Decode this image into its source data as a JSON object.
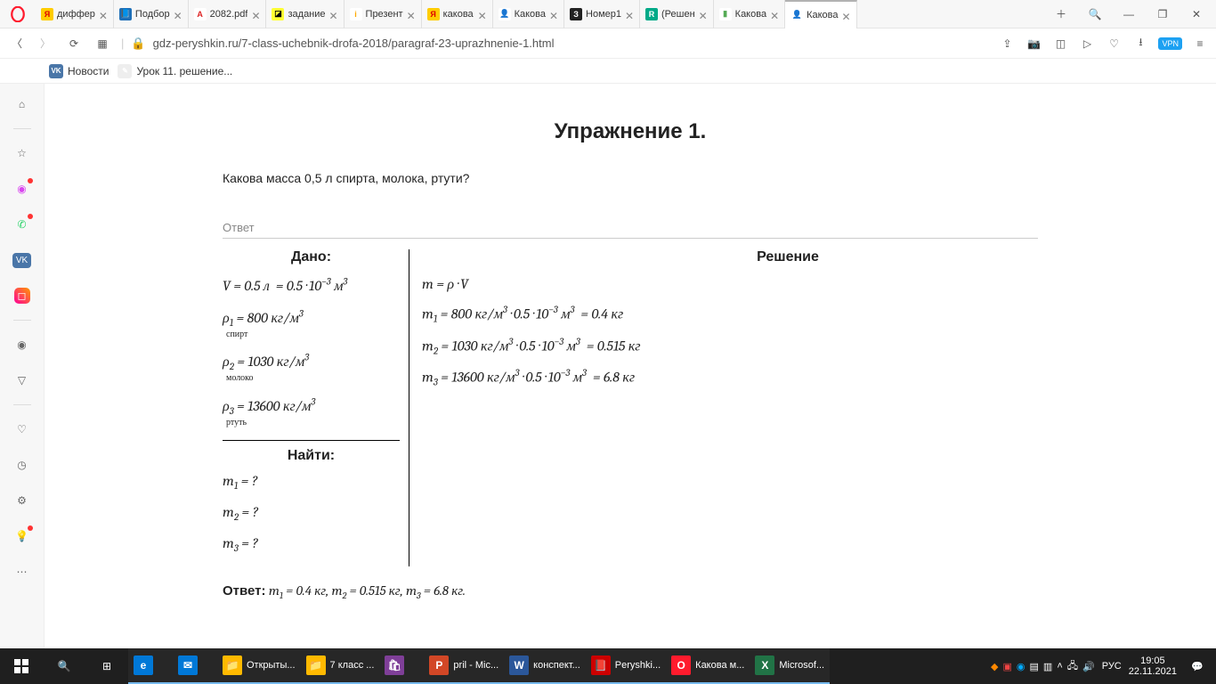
{
  "tabs": [
    {
      "label": "диффер",
      "color": "#ffcc00",
      "fg": "#d00",
      "letter": "Я"
    },
    {
      "label": "Подбор",
      "color": "#1e6fb8",
      "fg": "#fff",
      "letter": "📘"
    },
    {
      "label": "2082.pdf",
      "color": "#fff",
      "fg": "#d22",
      "letter": "A"
    },
    {
      "label": "задание",
      "color": "#ff3",
      "fg": "#000",
      "letter": "◪"
    },
    {
      "label": "Презент",
      "color": "#fff",
      "fg": "#fa0",
      "letter": "i"
    },
    {
      "label": "какова",
      "color": "#ffcc00",
      "fg": "#d00",
      "letter": "Я"
    },
    {
      "label": "Какова",
      "color": "#fff",
      "fg": "#b77",
      "letter": "👤"
    },
    {
      "label": "Номер1",
      "color": "#222",
      "fg": "#fff",
      "letter": "З"
    },
    {
      "label": "(Решен",
      "color": "#0a8",
      "fg": "#fff",
      "letter": "R"
    },
    {
      "label": "Какова",
      "color": "#fff",
      "fg": "#5a5",
      "letter": "▮"
    },
    {
      "label": "Какова",
      "color": "#fff",
      "fg": "#b77",
      "letter": "👤",
      "active": true
    }
  ],
  "url": "gdz-peryshkin.ru/7-class-uchebnik-drofa-2018/paragraf-23-uprazhnenie-1.html",
  "bookmarks": [
    {
      "label": "Новости",
      "bg": "#4a76a8",
      "letter": "VK"
    },
    {
      "label": "Урок 11. решение...",
      "bg": "#eee",
      "letter": "✎"
    }
  ],
  "page": {
    "title": "Упражнение 1.",
    "question": "Какова масса 0,5 л спирта, молока, ртути?",
    "answer_label": "Ответ",
    "dano": "Дано:",
    "g1": "V = 0.5 л  = 0.5 · 10⁻³ м³",
    "g2": "ρ₁ = 800 кг/м³",
    "g2n": "спирт",
    "g3": "ρ₂ = 1030 кг/м³",
    "g3n": "молоко",
    "g4": "ρ₃ = 13600 кг/м³",
    "g4n": "ртуть",
    "naiti": "Найти:",
    "f1": "m₁ = ?",
    "f2": "m₂ = ?",
    "f3": "m₃ = ?",
    "resh": "Решение",
    "s0": "m = ρ · V",
    "s1": "m₁ = 800 кг/м³ · 0.5 · 10⁻³ м³  = 0.4 кг",
    "s2": "m₂ = 1030 кг/м³ · 0.5 · 10⁻³ м³  = 0.515 кг",
    "s3": "m₃ = 13600 кг/м³ · 0.5 · 10⁻³ м³  = 6.8 кг",
    "final_label": "Ответ:",
    "final": " m₁ = 0.4 кг, m₂ = 0.515 кг, m₃ = 6.8 кг."
  },
  "taskbar": {
    "apps": [
      {
        "label": "",
        "bg": "#0078d7",
        "letter": "e"
      },
      {
        "label": "",
        "bg": "#0078d7",
        "letter": "✉"
      },
      {
        "label": "Открыты...",
        "bg": "#ffb900",
        "letter": "📁"
      },
      {
        "label": "7 класс ...",
        "bg": "#ffb900",
        "letter": "📁"
      },
      {
        "label": "",
        "bg": "#7f3f98",
        "letter": "🛍"
      },
      {
        "label": "pril - Mic...",
        "bg": "#d24726",
        "letter": "P"
      },
      {
        "label": "конспект...",
        "bg": "#2b579a",
        "letter": "W"
      },
      {
        "label": "Peryshki...",
        "bg": "#c00",
        "letter": "📕"
      },
      {
        "label": "Какова м...",
        "bg": "#ff1b2d",
        "letter": "O"
      },
      {
        "label": "Microsof...",
        "bg": "#217346",
        "letter": "X"
      }
    ],
    "lang": "РУС",
    "time": "19:05",
    "date": "22.11.2021"
  }
}
